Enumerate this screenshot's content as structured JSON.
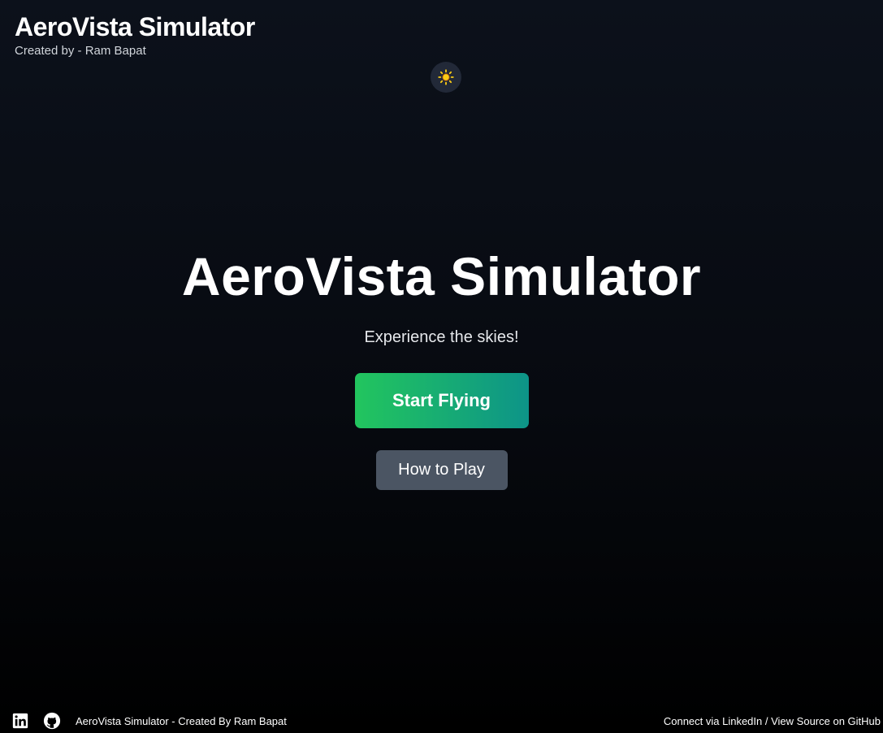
{
  "header": {
    "title": "AeroVista Simulator",
    "subtitle": "Created by - Ram Bapat"
  },
  "theme_toggle": {
    "icon": "sun-icon",
    "color": "#facc15"
  },
  "hero": {
    "title": "AeroVista Simulator",
    "tagline": "Experience the skies!",
    "start_button": "Start Flying",
    "howto_button": "How to Play"
  },
  "footer": {
    "icons": [
      "linkedin-icon",
      "github-icon"
    ],
    "credit": "AeroVista Simulator - Created By Ram Bapat",
    "linkedin_link": "Connect via LinkedIn",
    "separator": " / ",
    "github_link": "View Source on GitHub"
  },
  "colors": {
    "start_gradient": [
      "#22c55e",
      "#0d9488"
    ],
    "secondary_button": "#4b5563",
    "background": "#0c111b"
  }
}
